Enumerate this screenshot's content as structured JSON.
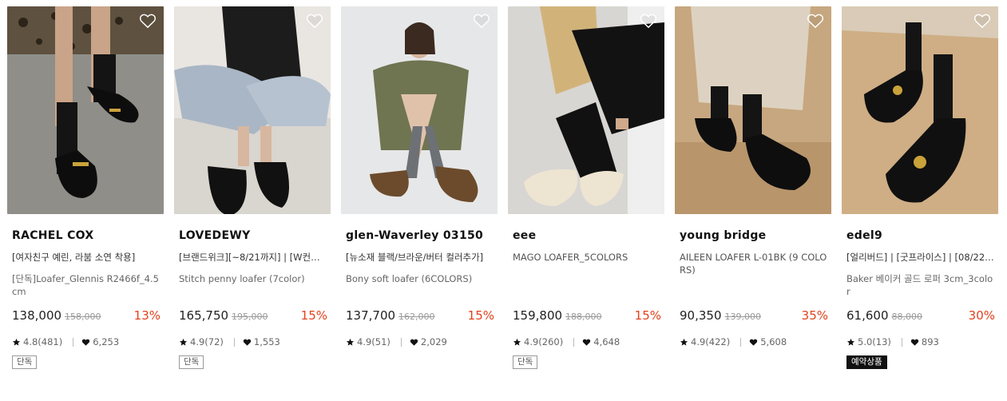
{
  "colors": {
    "discount": "#e2421c",
    "badge_dark": "#111111"
  },
  "icons": {
    "wishlist": "heart-outline-icon",
    "rating": "star-icon",
    "likes": "heart-filled-icon"
  },
  "products": [
    {
      "brand": "RACHEL COX",
      "promo": "[여자친구 예린, 라붐 소연 착용]",
      "name": "[단독]Loafer_Glennis R2466f_4.5cm",
      "price": "138,000",
      "original_price": "158,000",
      "discount": "13%",
      "rating": "4.8(481)",
      "likes": "6,253",
      "badge": "단독"
    },
    {
      "brand": "LOVEDEWY",
      "promo": "[브랜드위크][~8/21까지] | [W컨셉 …",
      "name": "Stitch penny loafer (7color)",
      "price": "165,750",
      "original_price": "195,000",
      "discount": "15%",
      "rating": "4.9(72)",
      "likes": "1,553",
      "badge": "단독"
    },
    {
      "brand": "glen-Waverley 03150",
      "promo": "[뉴소재 블랙/브라운/버터 컬러추가]",
      "name": "Bony soft loafer (6COLORS)",
      "price": "137,700",
      "original_price": "162,000",
      "discount": "15%",
      "rating": "4.9(51)",
      "likes": "2,029",
      "badge": ""
    },
    {
      "brand": "eee",
      "promo": "MAGO LOAFER_5COLORS",
      "name": "",
      "price": "159,800",
      "original_price": "188,000",
      "discount": "15%",
      "rating": "4.9(260)",
      "likes": "4,648",
      "badge": "단독"
    },
    {
      "brand": "young bridge",
      "promo": "AILEEN LOAFER L-01BK (9 COLORS)",
      "name": "",
      "price": "90,350",
      "original_price": "139,000",
      "discount": "35%",
      "rating": "4.9(422)",
      "likes": "5,608",
      "badge": ""
    },
    {
      "brand": "edel9",
      "promo": "[얼리버드] | [굿프라이스] | [08/22 …",
      "name": "Baker 베이커 골드 로퍼 3cm_3color",
      "price": "61,600",
      "original_price": "88,000",
      "discount": "30%",
      "rating": "5.0(13)",
      "likes": "893",
      "badge": "예약상품"
    }
  ]
}
